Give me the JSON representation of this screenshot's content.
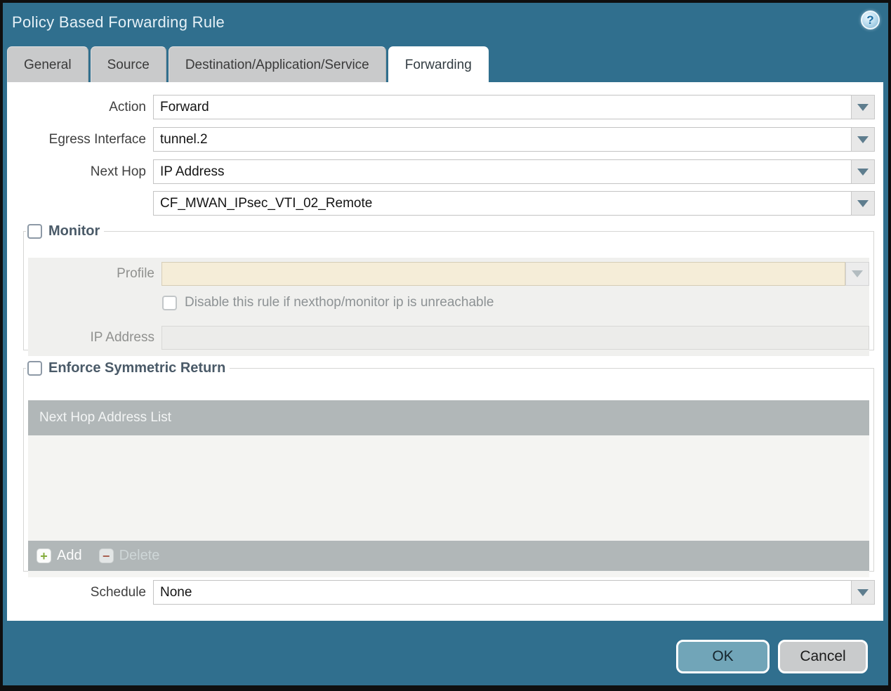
{
  "window": {
    "title": "Policy Based Forwarding Rule",
    "help_glyph": "?"
  },
  "tabs": [
    {
      "label": "General",
      "active": false
    },
    {
      "label": "Source",
      "active": false
    },
    {
      "label": "Destination/Application/Service",
      "active": false
    },
    {
      "label": "Forwarding",
      "active": true
    }
  ],
  "fields": {
    "action": {
      "label": "Action",
      "value": "Forward"
    },
    "egress_interface": {
      "label": "Egress Interface",
      "value": "tunnel.2"
    },
    "next_hop": {
      "label": "Next Hop",
      "value": "IP Address"
    },
    "next_hop_address": {
      "value": "CF_MWAN_IPsec_VTI_02_Remote"
    },
    "schedule": {
      "label": "Schedule",
      "value": "None"
    }
  },
  "monitor": {
    "legend": "Monitor",
    "checked": false,
    "profile": {
      "label": "Profile",
      "value": ""
    },
    "disable_rule_checkbox": {
      "label": "Disable this rule if nexthop/monitor ip is unreachable",
      "checked": false
    },
    "ip_address": {
      "label": "IP Address",
      "value": ""
    }
  },
  "enforce_symmetric_return": {
    "legend": "Enforce Symmetric Return",
    "checked": false,
    "table": {
      "header": "Next Hop Address List",
      "rows": []
    },
    "toolbar": {
      "add_label": "Add",
      "delete_label": "Delete"
    }
  },
  "footer": {
    "ok_label": "OK",
    "cancel_label": "Cancel"
  },
  "colors": {
    "titlebar_teal": "#306f8e",
    "ok_button": "#71a5b8",
    "cancel_button": "#c9cbcc",
    "table_header_gray": "#b1b7b8",
    "disabled_profile_field": "#f5edd8",
    "disabled_panel": "#f0f0ee",
    "add_icon_green": "#84ac3b",
    "delete_icon_red": "#a85f50"
  }
}
